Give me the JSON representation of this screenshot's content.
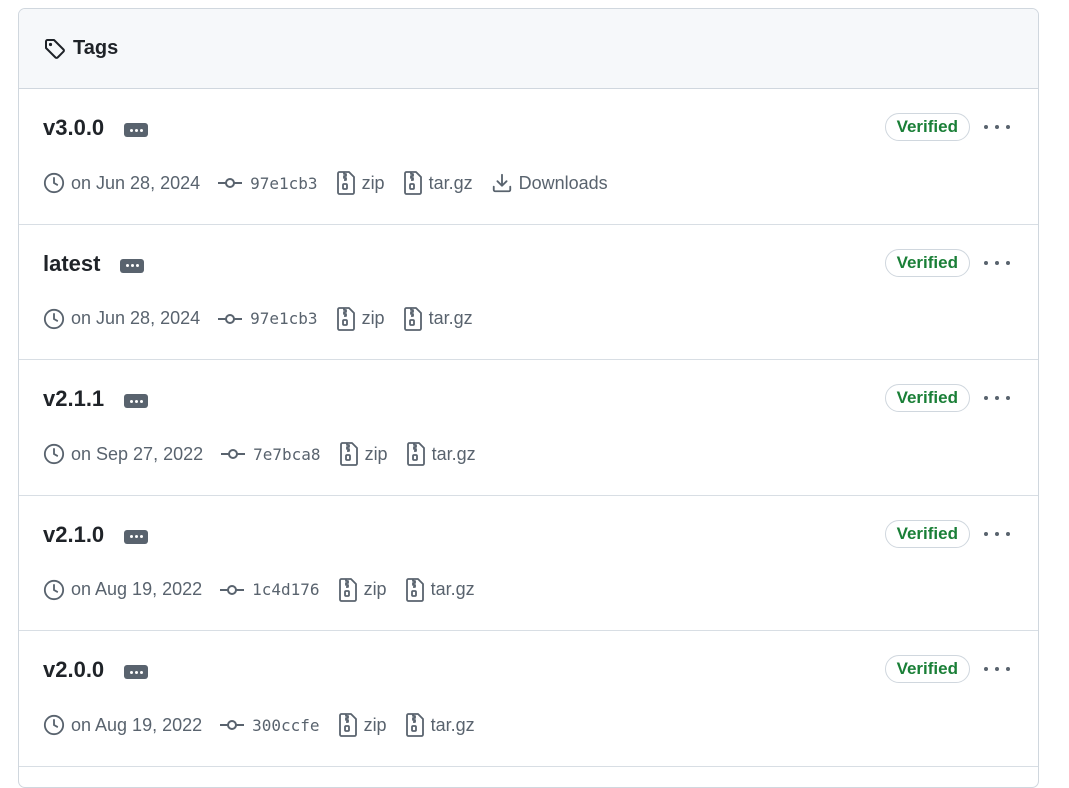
{
  "header": {
    "title": "Tags",
    "icon": "tag-icon"
  },
  "badge_label": "Verified",
  "downloads_label": "Downloads",
  "tags": [
    {
      "name": "v3.0.0",
      "date": "on Jun 28, 2024",
      "commit": "97e1cb3",
      "zip": "zip",
      "targz": "tar.gz",
      "downloads": "Downloads"
    },
    {
      "name": "latest",
      "date": "on Jun 28, 2024",
      "commit": "97e1cb3",
      "zip": "zip",
      "targz": "tar.gz",
      "downloads": null
    },
    {
      "name": "v2.1.1",
      "date": "on Sep 27, 2022",
      "commit": "7e7bca8",
      "zip": "zip",
      "targz": "tar.gz",
      "downloads": null
    },
    {
      "name": "v2.1.0",
      "date": "on Aug 19, 2022",
      "commit": "1c4d176",
      "zip": "zip",
      "targz": "tar.gz",
      "downloads": null
    },
    {
      "name": "v2.0.0",
      "date": "on Aug 19, 2022",
      "commit": "300ccfe",
      "zip": "zip",
      "targz": "tar.gz",
      "downloads": null
    }
  ],
  "colors": {
    "verified": "#1a7f37",
    "muted": "#59636e",
    "border": "#d0d7de",
    "header_bg": "#f6f8fa"
  }
}
